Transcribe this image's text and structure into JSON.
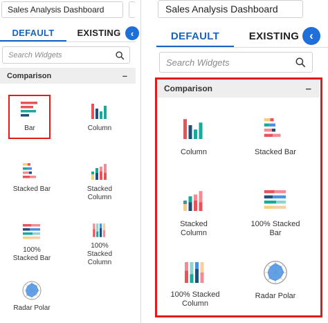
{
  "left": {
    "title": "Sales Analysis Dashboard",
    "tabs": [
      {
        "label": "DEFAULT"
      },
      {
        "label": "EXISTING"
      }
    ],
    "search_placeholder": "Search Widgets",
    "section": "Comparison",
    "collapse_symbol": "–",
    "widgets": [
      {
        "label": "Bar",
        "icon": "bar-chart-icon"
      },
      {
        "label": "Column",
        "icon": "column-chart-icon"
      },
      {
        "label": "Stacked Bar",
        "icon": "stacked-bar-chart-icon"
      },
      {
        "label": "Stacked Column",
        "icon": "stacked-column-chart-icon"
      },
      {
        "label": "100% Stacked Bar",
        "icon": "stacked-bar-100-chart-icon"
      },
      {
        "label": "100% Stacked Column",
        "icon": "stacked-column-100-chart-icon"
      },
      {
        "label": "Radar Polar",
        "icon": "radar-polar-chart-icon"
      }
    ]
  },
  "right": {
    "title": "Sales Analysis Dashboard",
    "tabs": [
      {
        "label": "DEFAULT"
      },
      {
        "label": "EXISTING"
      }
    ],
    "search_placeholder": "Search Widgets",
    "section": "Comparison",
    "collapse_symbol": "–",
    "widgets": [
      {
        "label": "Column",
        "icon": "column-chart-icon"
      },
      {
        "label": "Stacked Bar",
        "icon": "stacked-bar-chart-icon"
      },
      {
        "label": "Stacked Column",
        "icon": "stacked-column-chart-icon"
      },
      {
        "label": "100% Stacked Bar",
        "icon": "stacked-bar-100-chart-icon"
      },
      {
        "label": "100% Stacked Column",
        "icon": "stacked-column-100-chart-icon"
      },
      {
        "label": "Radar Polar",
        "icon": "radar-polar-chart-icon"
      }
    ]
  },
  "colors": {
    "accent": "#1565c0",
    "collapse_button": "#1e6fd9",
    "highlight": "#e01b1b",
    "icon_red": "#e8535a",
    "icon_pink": "#f28b93",
    "icon_teal": "#17a99a",
    "icon_navy": "#1f4e79",
    "icon_blue": "#4a90e2",
    "icon_yellow": "#f6cf7a",
    "icon_peach": "#f7cfa3"
  }
}
